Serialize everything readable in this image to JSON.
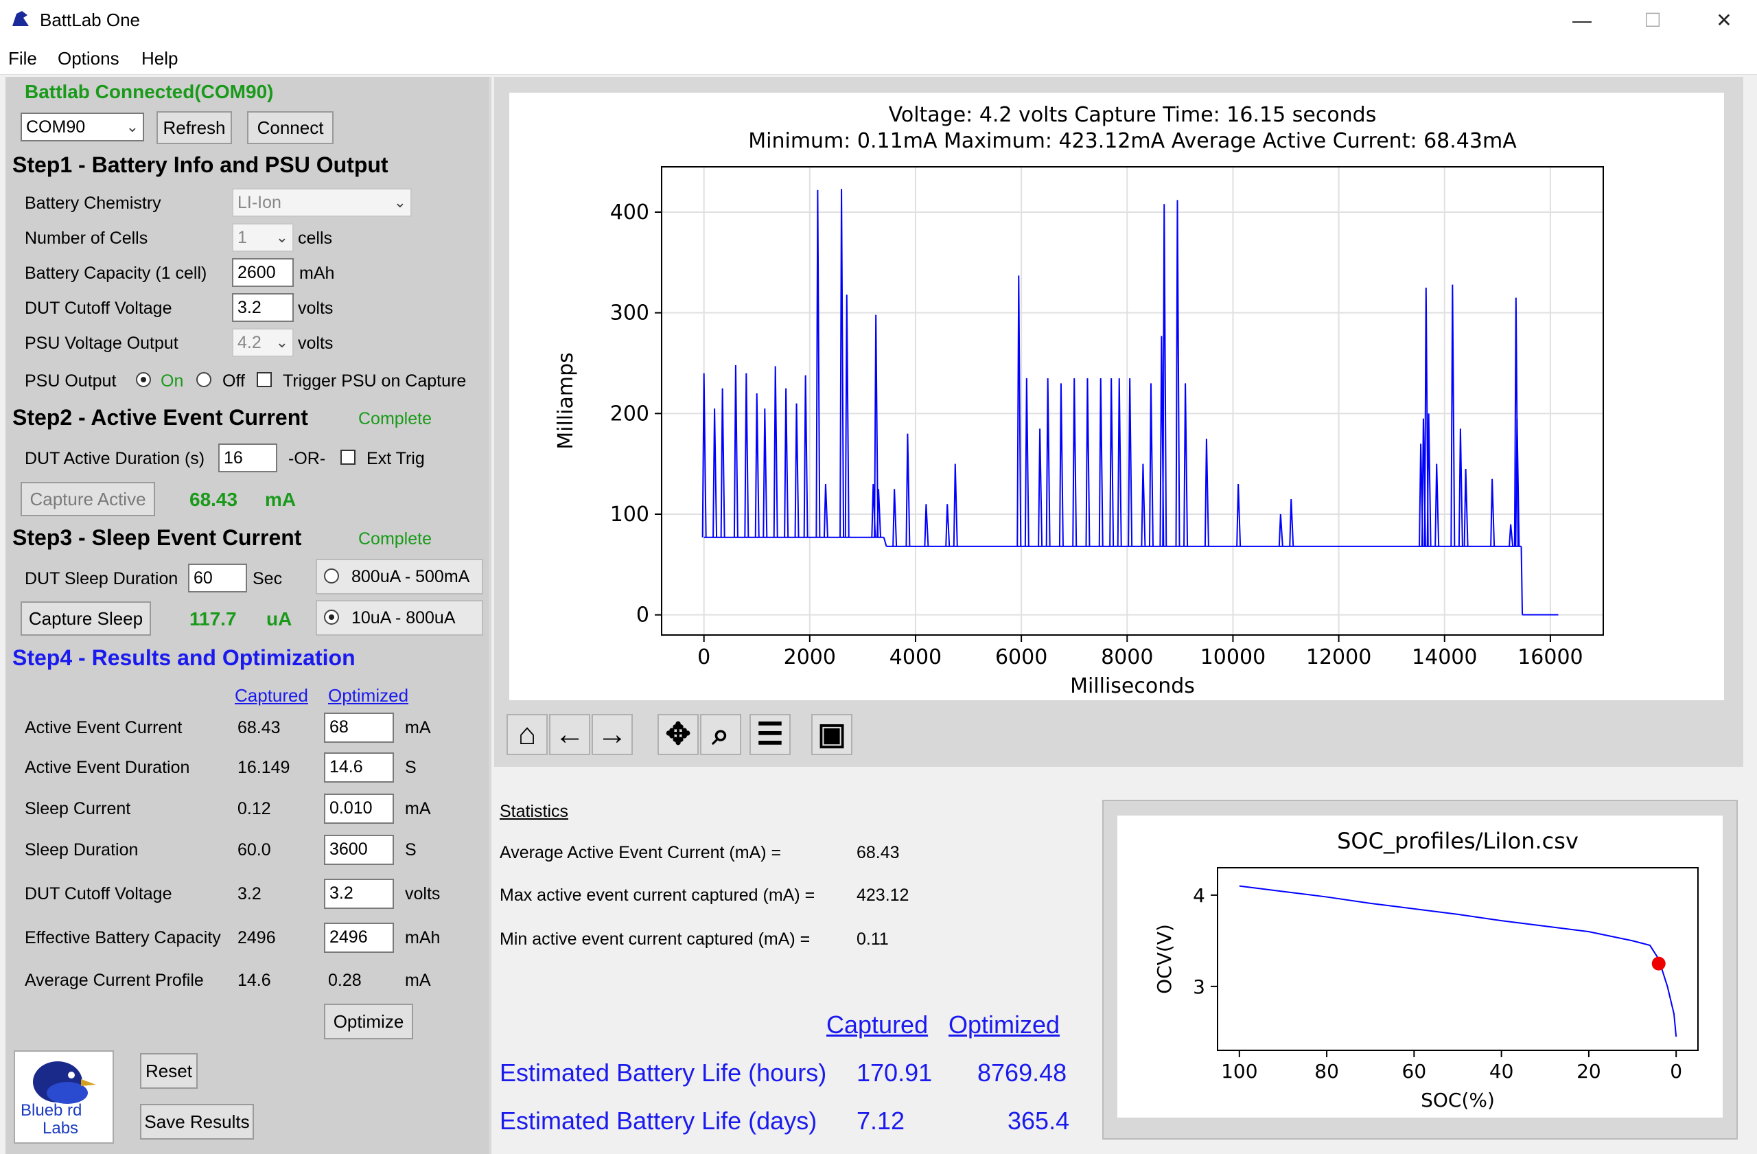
{
  "window": {
    "title": "BattLab One",
    "minimize": "—",
    "maximize": "☐",
    "close": "✕"
  },
  "menu": [
    "File",
    "Options",
    "Help"
  ],
  "connection": {
    "status": "Battlab Connected(COM90)",
    "port_value": "COM90",
    "refresh_label": "Refresh",
    "connect_label": "Connect"
  },
  "step1": {
    "title": "Step1 - Battery Info and PSU Output",
    "chemistry_label": "Battery Chemistry",
    "chemistry_value": "LI-Ion",
    "cells_label": "Number of Cells",
    "cells_value": "1",
    "cells_unit": "cells",
    "capacity_label": "Battery Capacity (1 cell)",
    "capacity_value": "2600",
    "capacity_unit": "mAh",
    "cutoff_label": "DUT Cutoff Voltage",
    "cutoff_value": "3.2",
    "cutoff_unit": "volts",
    "psu_voltage_label": "PSU Voltage Output",
    "psu_voltage_value": "4.2",
    "psu_voltage_unit": "volts",
    "psu_output_label": "PSU Output",
    "on_label": "On",
    "off_label": "Off",
    "trigger_label": "Trigger PSU on Capture"
  },
  "step2": {
    "title": "Step2 - Active Event Current",
    "status": "Complete",
    "duration_label": "DUT Active Duration (s)",
    "duration_value": "16",
    "or_label": "-OR-",
    "ext_trig_label": "Ext Trig",
    "capture_label": "Capture Active",
    "result_value": "68.43",
    "result_unit": "mA"
  },
  "step3": {
    "title": "Step3 - Sleep Event Current",
    "status": "Complete",
    "duration_label": "DUT Sleep Duration",
    "duration_value": "60",
    "duration_unit": "Sec",
    "range_high_label": "800uA - 500mA",
    "range_low_label": "10uA - 800uA",
    "capture_label": "Capture Sleep",
    "result_value": "117.7",
    "result_unit": "uA"
  },
  "step4": {
    "title": "Step4 - Results and Optimization",
    "col_captured": "Captured",
    "col_optimized": "Optimized",
    "rows": [
      {
        "label": "Active Event Current",
        "captured": "68.43",
        "optimized": "68",
        "unit": "mA"
      },
      {
        "label": "Active Event Duration",
        "captured": "16.149",
        "optimized": "14.6",
        "unit": "S"
      },
      {
        "label": "Sleep Current",
        "captured": "0.12",
        "optimized": "0.010",
        "unit": "mA"
      },
      {
        "label": "Sleep Duration",
        "captured": "60.0",
        "optimized": "3600",
        "unit": "S"
      },
      {
        "label": "DUT Cutoff Voltage",
        "captured": "3.2",
        "optimized": "3.2",
        "unit": "volts"
      },
      {
        "label": "Effective Battery Capacity",
        "captured": "2496",
        "optimized": "2496",
        "unit": "mAh"
      },
      {
        "label": "Average Current Profile",
        "captured": "14.6",
        "optimized": "0.28",
        "unit": "mA"
      }
    ],
    "optimize_label": "Optimize",
    "reset_label": "Reset",
    "save_label": "Save Results",
    "logo_text_1": "Blueb rd",
    "logo_text_2": "Labs"
  },
  "statistics": {
    "title": "Statistics",
    "avg_label": "Average Active Event Current (mA) =",
    "avg_value": "68.43",
    "max_label": "Max active event current captured (mA) =",
    "max_value": "423.12",
    "min_label": "Min active event current captured (mA) =",
    "min_value": "0.11",
    "col_captured": "Captured",
    "col_optimized": "Optimized",
    "life_hours_label": "Estimated Battery Life (hours)",
    "life_hours_captured": "170.91",
    "life_hours_optimized": "8769.48",
    "life_days_label": "Estimated Battery Life (days)",
    "life_days_captured": "7.12",
    "life_days_optimized": "365.4"
  },
  "toolbar_icons": [
    "home-icon",
    "back-arrow-icon",
    "forward-arrow-icon",
    "pan-icon",
    "zoom-icon",
    "configure-icon",
    "save-icon"
  ],
  "chart_data": [
    {
      "type": "line",
      "title": "Voltage: 4.2 volts   Capture Time:  16.15 seconds",
      "subtitle": "Minimum: 0.11mA    Maximum: 423.12mA    Average Active Current: 68.43mA",
      "xlabel": "Milliseconds",
      "ylabel": "Milliamps",
      "xlim": [
        -800,
        17000
      ],
      "ylim": [
        -20,
        445
      ],
      "xticks": [
        0,
        2000,
        4000,
        6000,
        8000,
        10000,
        12000,
        14000,
        16000
      ],
      "yticks": [
        0,
        100,
        200,
        300,
        400
      ],
      "grid": true,
      "color": "#0000ff",
      "baseline_segments": [
        {
          "x": [
            0,
            3400
          ],
          "y": 77
        },
        {
          "x": [
            3450,
            15450
          ],
          "y": 68
        },
        {
          "x": [
            15470,
            16150
          ],
          "y": 0.11
        }
      ],
      "spikes": [
        [
          0,
          240
        ],
        [
          200,
          205
        ],
        [
          350,
          225
        ],
        [
          600,
          248
        ],
        [
          800,
          240
        ],
        [
          1000,
          220
        ],
        [
          1150,
          205
        ],
        [
          1350,
          247
        ],
        [
          1550,
          225
        ],
        [
          1750,
          210
        ],
        [
          1920,
          238
        ],
        [
          2150,
          422
        ],
        [
          2300,
          130
        ],
        [
          2600,
          423
        ],
        [
          2700,
          318
        ],
        [
          3200,
          130
        ],
        [
          3250,
          298
        ],
        [
          3300,
          125
        ],
        [
          3600,
          125
        ],
        [
          3850,
          180
        ],
        [
          4200,
          110
        ],
        [
          4600,
          110
        ],
        [
          4750,
          150
        ],
        [
          5950,
          337
        ],
        [
          6100,
          235
        ],
        [
          6350,
          185
        ],
        [
          6500,
          235
        ],
        [
          6750,
          230
        ],
        [
          7000,
          235
        ],
        [
          7250,
          235
        ],
        [
          7500,
          235
        ],
        [
          7700,
          235
        ],
        [
          7850,
          235
        ],
        [
          8050,
          235
        ],
        [
          8300,
          150
        ],
        [
          8450,
          230
        ],
        [
          8650,
          277
        ],
        [
          8700,
          408
        ],
        [
          8950,
          412
        ],
        [
          9100,
          230
        ],
        [
          9500,
          175
        ],
        [
          10100,
          130
        ],
        [
          10900,
          100
        ],
        [
          11100,
          115
        ],
        [
          13550,
          170
        ],
        [
          13600,
          195
        ],
        [
          13650,
          325
        ],
        [
          13700,
          200
        ],
        [
          13850,
          150
        ],
        [
          14150,
          328
        ],
        [
          14300,
          185
        ],
        [
          14400,
          145
        ],
        [
          14900,
          135
        ],
        [
          15250,
          90
        ],
        [
          15350,
          315
        ],
        [
          15370,
          195
        ]
      ]
    },
    {
      "type": "line",
      "title": "SOC_profiles/LiIon.csv",
      "xlabel": "SOC(%)",
      "ylabel": "OCV(V)",
      "xlim": [
        105,
        -5
      ],
      "ylim": [
        2.3,
        4.3
      ],
      "xticks": [
        100,
        80,
        60,
        40,
        20,
        0
      ],
      "yticks": [
        3,
        4
      ],
      "grid": false,
      "color": "#0000ff",
      "x": [
        100,
        90,
        80,
        70,
        60,
        50,
        40,
        30,
        20,
        10,
        6,
        4,
        2,
        0.5,
        0
      ],
      "y": [
        4.1,
        4.04,
        3.98,
        3.91,
        3.85,
        3.79,
        3.72,
        3.66,
        3.6,
        3.5,
        3.45,
        3.3,
        3.0,
        2.7,
        2.45
      ],
      "marker": {
        "x": 4,
        "y": 3.25,
        "color": "#ee0000"
      }
    }
  ]
}
